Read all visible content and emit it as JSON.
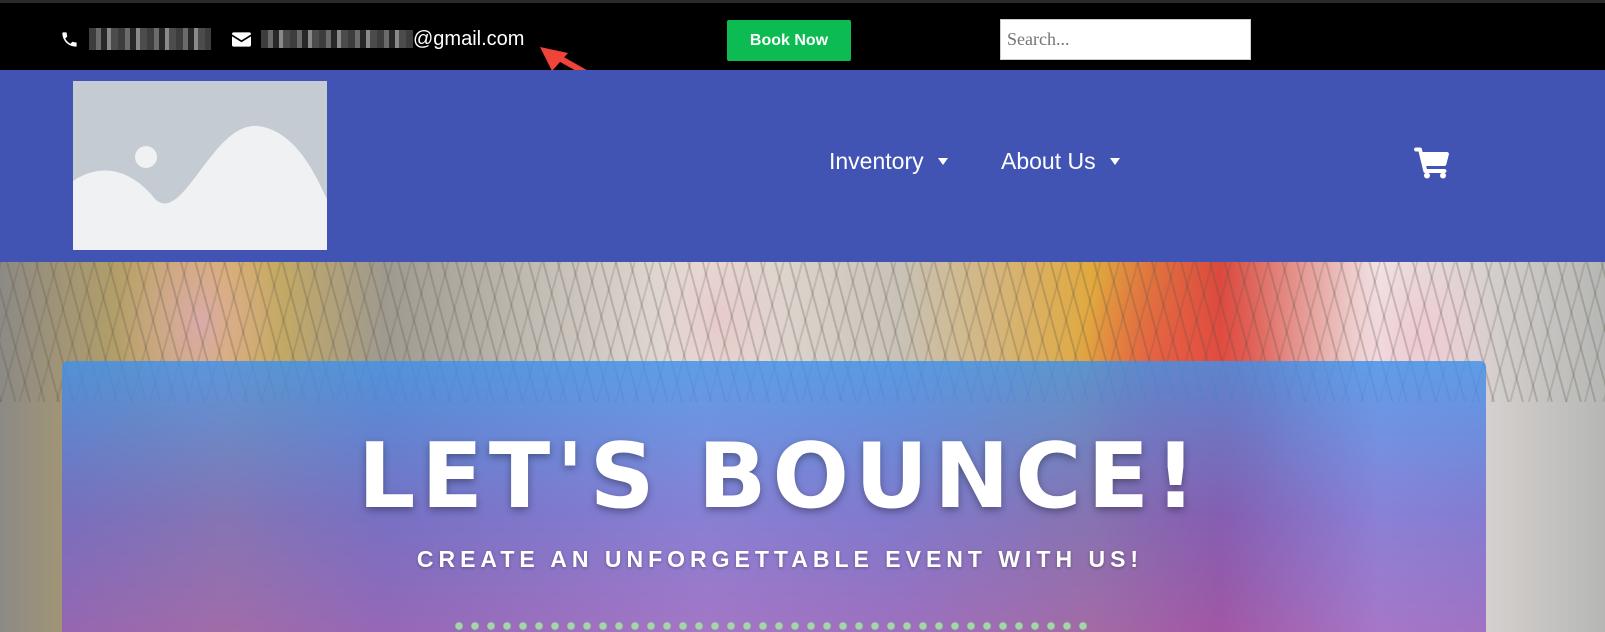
{
  "topbar": {
    "phone_icon": "phone-icon",
    "email_icon": "envelope-icon",
    "email_domain": "@gmail.com",
    "book_now_label": "Book Now",
    "search_placeholder": "Search..."
  },
  "header": {
    "nav": [
      {
        "label": "Inventory"
      },
      {
        "label": "About Us"
      }
    ],
    "cart_icon": "shopping-cart-icon"
  },
  "hero": {
    "title": "LET'S BOUNCE!",
    "subtitle": "CREATE AN UNFORGETTABLE EVENT WITH US!"
  },
  "colors": {
    "topbar_bg": "#000000",
    "header_bg": "#4154b3",
    "book_button": "#0cbb52",
    "annotation_arrow": "#f0433a"
  }
}
